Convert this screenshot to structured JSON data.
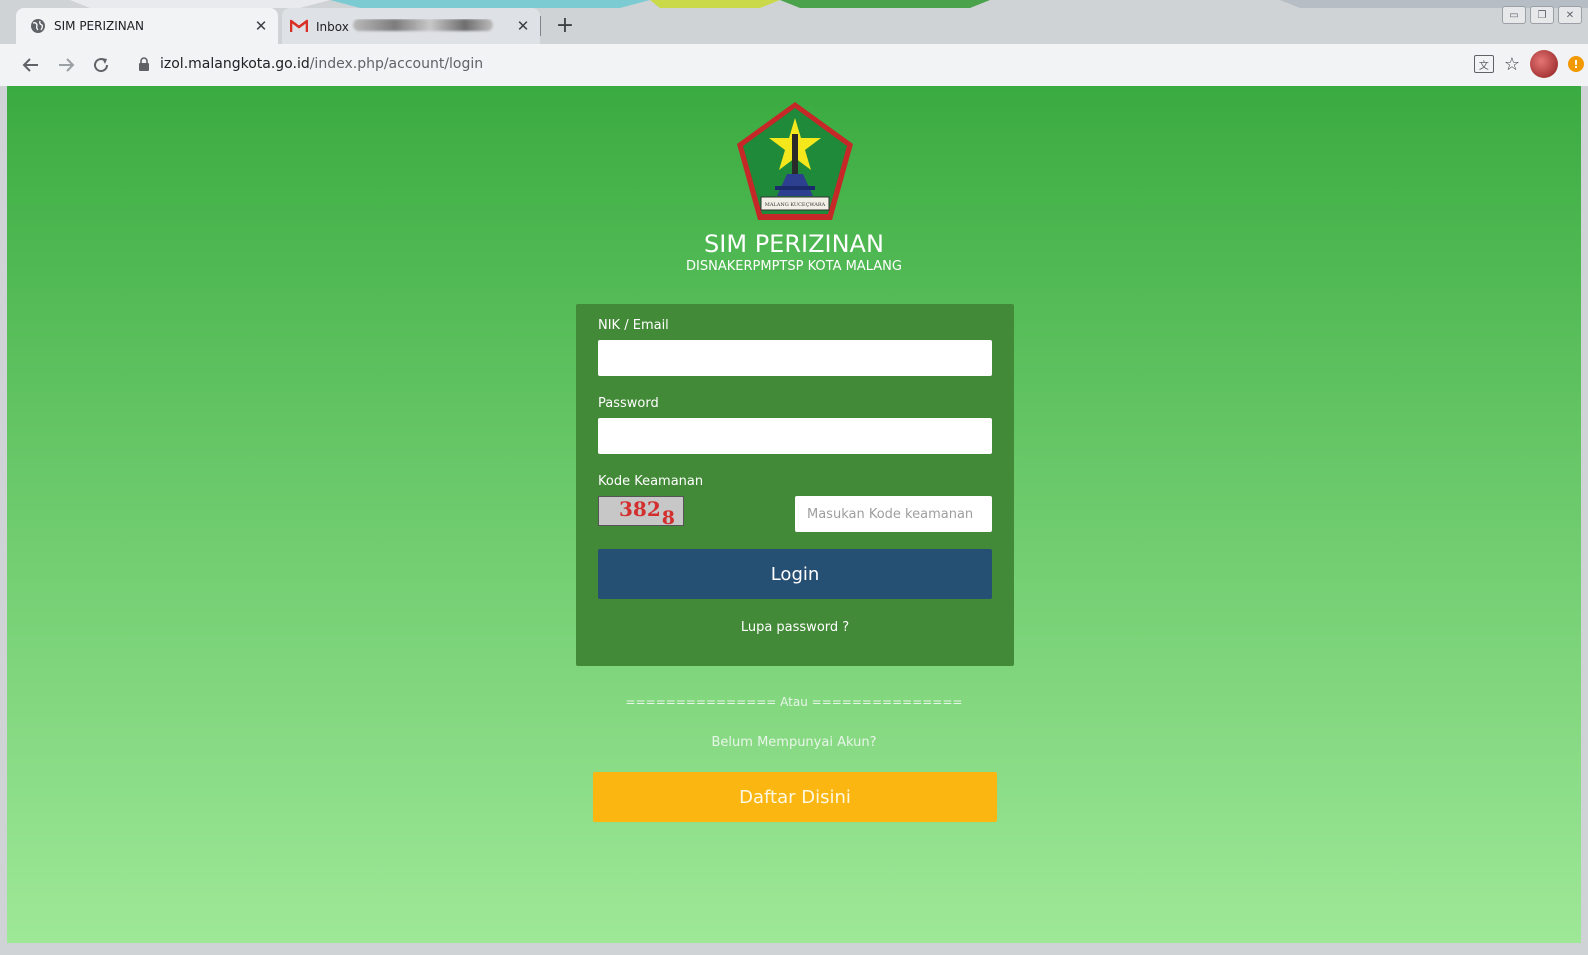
{
  "browser": {
    "tabs": [
      {
        "title": "SIM PERIZINAN",
        "active": true,
        "icon": "globe-icon"
      },
      {
        "title": "Inbox",
        "active": false,
        "icon": "gmail-icon"
      }
    ],
    "close_glyph": "✕",
    "new_tab_glyph": "+",
    "url_host": "izol.malangkota.go.id",
    "url_path": "/index.php/account/login",
    "window_controls": [
      "▭",
      "❐",
      "✕"
    ],
    "notification_glyph": "!"
  },
  "page": {
    "title": "SIM PERIZINAN",
    "subtitle": "DISNAKERPMPTSP KOTA MALANG",
    "logo_caption": "MALANG KUCEÇWARA",
    "form": {
      "nik_label": "NIK / Email",
      "nik_value": "",
      "password_label": "Password",
      "password_value": "",
      "security_label": "Kode Keamanan",
      "captcha_main": "382",
      "captcha_sub": "8",
      "security_placeholder": "Masukan Kode keamanan",
      "login_label": "Login",
      "forgot_label": "Lupa password ?"
    },
    "separator": "=============== Atau ===============",
    "no_account": "Belum Mempunyai Akun?",
    "register_label": "Daftar Disini"
  },
  "colors": {
    "page_top": "#3aab40",
    "page_bottom": "#9ee897",
    "card": "#438a38",
    "login_button": "#264f74",
    "register_button": "#fbb612"
  }
}
